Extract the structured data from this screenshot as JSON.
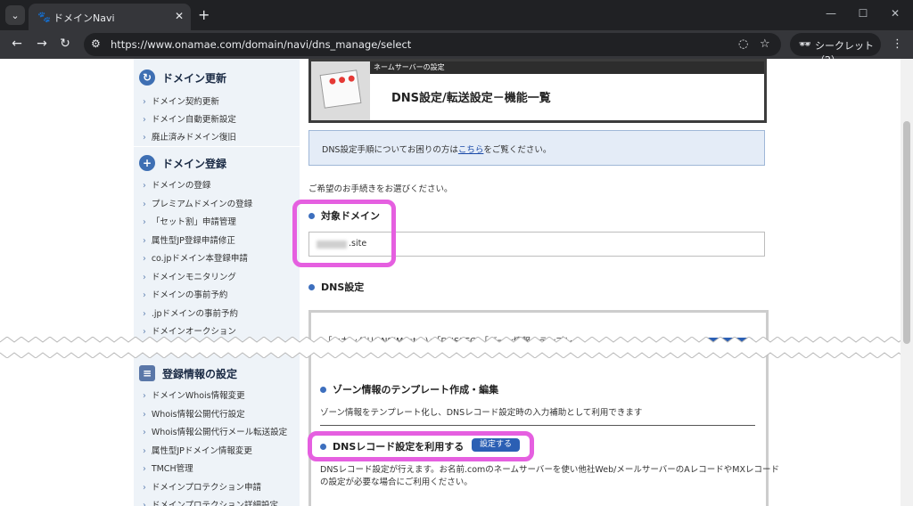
{
  "browser": {
    "tab_title": "ドメインNavi",
    "url": "https://www.onamae.com/domain/navi/dns_manage/select",
    "profile_label": "シークレット（2）"
  },
  "sidebar": {
    "renew": {
      "heading": "ドメイン更新",
      "items": [
        "ドメイン契約更新",
        "ドメイン自動更新設定",
        "廃止済みドメイン復旧"
      ]
    },
    "register": {
      "heading": "ドメイン登録",
      "items": [
        "ドメインの登録",
        "プレミアムドメインの登録",
        "「セット割」申請管理",
        "属性型JP登録申請修正",
        "co.jpドメイン本登録申請",
        "ドメインモニタリング",
        "ドメインの事前予約",
        ".jpドメインの事前予約",
        "ドメインオークション"
      ]
    },
    "info": {
      "heading": "登録情報の設定",
      "items": [
        "ドメインWhois情報変更",
        "Whois情報公開代行設定",
        "Whois情報公開代行メール転送設定",
        "属性型JPドメイン情報変更",
        "TMCH管理",
        "ドメインプロテクション申請",
        "ドメインプロテクション詳細設定"
      ]
    }
  },
  "main": {
    "header_band": "ネームサーバーの設定",
    "header_title": "DNS設定/転送設定－機能一覧",
    "notice_prefix": "DNS設定手順についてお困りの方は",
    "notice_link": "こちら",
    "notice_suffix": "をご覧ください。",
    "instruction": "ご希望のお手続きをお選びください。",
    "target_domain_label": "対象ドメイン",
    "domain_suffix": ".site",
    "dns_settings_label": "DNS設定",
    "dns_partial_text": "「セカンダリDNS(Master)」「DNSSEC」「ゾーン情報のテンプレー",
    "zone_template_title": "ゾーン情報のテンプレート作成・編集",
    "zone_template_desc": "ゾーン情報をテンプレート化し、DNSレコード設定時の入力補助として利用できます",
    "dns_record_title": "DNSレコード設定を利用する",
    "set_button": "設定する",
    "dns_record_desc_1": "DNSレコード設定が行えます。お名前.comのネームサーバーを使い他社Web/メールサーバーのAレコードやMXレコード",
    "dns_record_desc_2": "の設定が必要な場合にご利用ください。"
  }
}
